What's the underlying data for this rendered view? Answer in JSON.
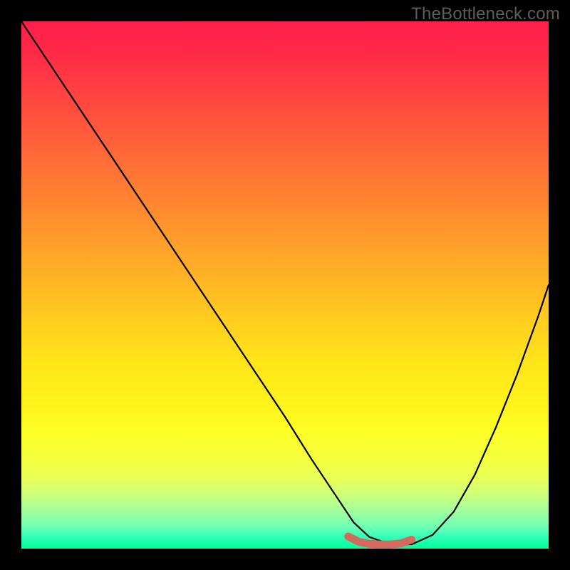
{
  "watermark": "TheBottleneck.com",
  "colors": {
    "curve": "#000000",
    "marker": "#d46a5f",
    "frame": "#000000"
  },
  "chart_data": {
    "type": "line",
    "title": "",
    "xlabel": "",
    "ylabel": "",
    "xlim": [
      0,
      100
    ],
    "ylim": [
      0,
      100
    ],
    "grid": false,
    "series": [
      {
        "name": "bottleneck-curve",
        "x": [
          0,
          5,
          10,
          15,
          20,
          25,
          30,
          35,
          40,
          45,
          50,
          55,
          60,
          63,
          66,
          70,
          74,
          78,
          82,
          86,
          90,
          94,
          98,
          100
        ],
        "y": [
          100,
          92.5,
          85,
          77.5,
          70,
          62.5,
          55,
          47.5,
          40,
          32.5,
          25,
          17,
          9.5,
          5,
          2.2,
          0.8,
          0.8,
          2.6,
          7,
          14,
          23,
          33,
          44,
          50
        ]
      },
      {
        "name": "optimal-range",
        "x": [
          62,
          64,
          66,
          68,
          70,
          72,
          74
        ],
        "y": [
          2.3,
          1.3,
          0.9,
          0.8,
          0.8,
          1.0,
          1.7
        ]
      }
    ],
    "annotations": []
  }
}
